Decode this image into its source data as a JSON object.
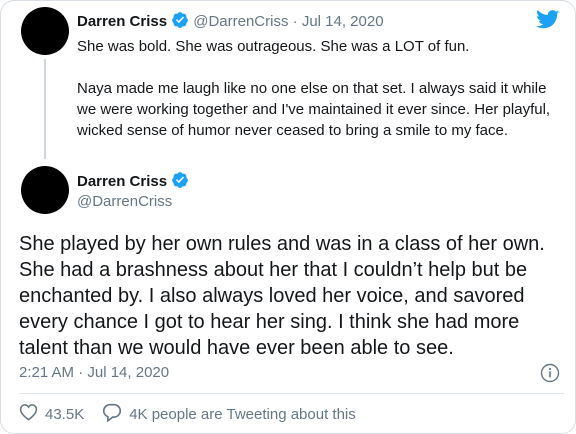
{
  "parent_tweet": {
    "name": "Darren Criss",
    "handle": "@DarrenCriss",
    "separator": "·",
    "date": "Jul 14, 2020",
    "paragraphs": [
      "She was bold. She was outrageous. She was a LOT of fun.",
      "Naya made me laugh like no one else on that set. I always said it while we were working together and I've maintained it ever since. Her playful, wicked sense of humor never ceased to bring a smile to my face."
    ]
  },
  "main_tweet": {
    "name": "Darren Criss",
    "handle": "@DarrenCriss",
    "text": "She played by her own rules and was in a class of her own. She had a brashness about her that I couldn’t help but be enchanted by. I also always loved her voice, and savored every chance I got to hear her sing. I think she had more talent than we would have ever been able to see.",
    "timestamp": "2:21 AM · Jul 14, 2020",
    "likes": "43.5K",
    "tweeting": "4K people are Tweeting about this"
  },
  "icons": {
    "verified": "verified-badge-icon",
    "twitter": "twitter-bird-icon",
    "info": "info-icon",
    "heart": "heart-icon",
    "comment": "speech-bubble-icon"
  },
  "colors": {
    "brand": "#1DA1F2",
    "secondary_text": "#657786",
    "avatar": "#000000"
  }
}
